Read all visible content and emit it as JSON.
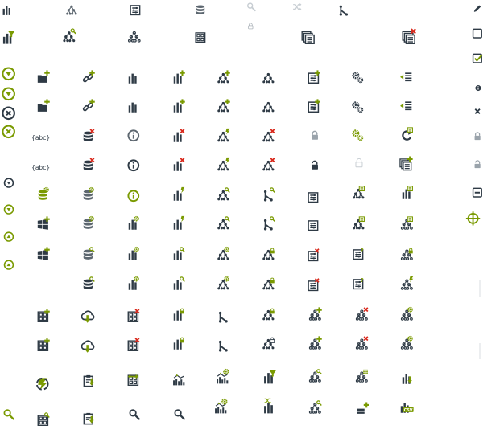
{
  "colors": {
    "dark": "#2e3a45",
    "green": "#7a9a01",
    "red": "#d9291c",
    "gray": "#5d6770",
    "light": "#9aa3ab",
    "faint": "#c8ced3"
  },
  "badges": {
    "csv": "CSV",
    "abc": "abc",
    "question": "?"
  },
  "icons": [
    "bars-icon",
    "tree-icon",
    "report-icon",
    "database-icon",
    "search-icon",
    "cross-icon",
    "branch-icon",
    "edit-pencil-icon",
    "bars-filter-icon",
    "tree-search-icon",
    "tree-dashed-icon",
    "grid-icon",
    "lock-icon",
    "report-stack-icon",
    "report-stack-remove-icon",
    "checkbox-empty-icon",
    "checkbox-checked-icon",
    "info-icon",
    "close-icon",
    "lock-icon",
    "unlock-icon",
    "collapse-icon",
    "target-icon",
    "expand-icon",
    "expand-icon",
    "remove-icon",
    "remove-icon",
    "arrow-down-icon",
    "arrow-down-icon",
    "arrow-up-icon",
    "arrow-up-icon",
    "folder-add-icon",
    "folder-add-icon",
    "variable-icon",
    "variable-icon",
    "database-settings-icon",
    "windows-add-icon",
    "windows-add-icon",
    "link-add-icon",
    "link-add-icon",
    "database-remove-icon",
    "database-remove-icon",
    "database-settings-icon",
    "database-settings-icon",
    "database-search-icon",
    "database-search-icon",
    "bars-icon",
    "bars-icon",
    "info-icon",
    "info-icon",
    "info-icon",
    "bars-settings-icon",
    "bars-settings-icon",
    "bars-settings-icon",
    "bars-add-icon",
    "bars-add-icon",
    "bars-remove-icon",
    "bars-remove-icon",
    "bars-refresh-icon",
    "bars-refresh-icon",
    "bars-search-icon",
    "bars-search-icon",
    "tree-add-icon",
    "tree-add-icon",
    "tree-refresh-icon",
    "tree-refresh-icon",
    "tree-search-icon",
    "tree-search-icon",
    "tree-settings-icon",
    "tree-settings-icon",
    "tree-icon",
    "tree-icon",
    "tree-remove-icon",
    "tree-remove-icon",
    "branch-search-icon",
    "branch-search-icon",
    "tree-lock-icon",
    "tree-unlock-icon",
    "report-add-icon",
    "report-add-icon",
    "lock-icon",
    "unlock-icon",
    "report-icon",
    "report-icon",
    "report-remove-icon",
    "report-remove-icon",
    "settings-icon",
    "settings-icon",
    "settings-icon",
    "lock-faint-icon",
    "report-view-icon",
    "report-view-icon",
    "report-help-icon",
    "report-help-icon",
    "indent-add-icon",
    "indent-add-icon",
    "refresh-report-icon",
    "report-stack-add-icon",
    "bars-report-icon",
    "tree-dashed-report-icon",
    "tree-dashed-lock-icon",
    "tree-dashed-refresh-icon",
    "grid-add-icon",
    "grid-add-icon",
    "cloud-download-icon",
    "cloud-download-icon",
    "grid-remove-icon",
    "grid-remove-icon",
    "bars-lock-icon",
    "bars-lock-icon",
    "branch-icon",
    "branch-icon",
    "tree-lock-icon",
    "tree-unlock-icon",
    "tree-dashed-add-icon",
    "tree-dashed-add-icon",
    "tree-dashed-remove-icon",
    "tree-dashed-remove-icon",
    "tree-dashed-settings-icon",
    "tree-dashed-settings-icon",
    "refresh-icon",
    "clipboard-download-icon",
    "clipboard-download-icon",
    "grid-expand-icon",
    "bars-tree-icon",
    "bars-tree-settings-icon",
    "bars-filter-icon",
    "tree-dashed-search-icon",
    "tree-dashed-grid-icon",
    "bars-download-icon",
    "search-icon",
    "grid-search-icon",
    "search-icon",
    "search-icon",
    "bars-tree-settings-icon",
    "bars-shuffle-icon",
    "tree-dashed-search-icon",
    "equals-add-icon",
    "bars-csv-icon",
    "divider-icon",
    "divider-icon"
  ]
}
